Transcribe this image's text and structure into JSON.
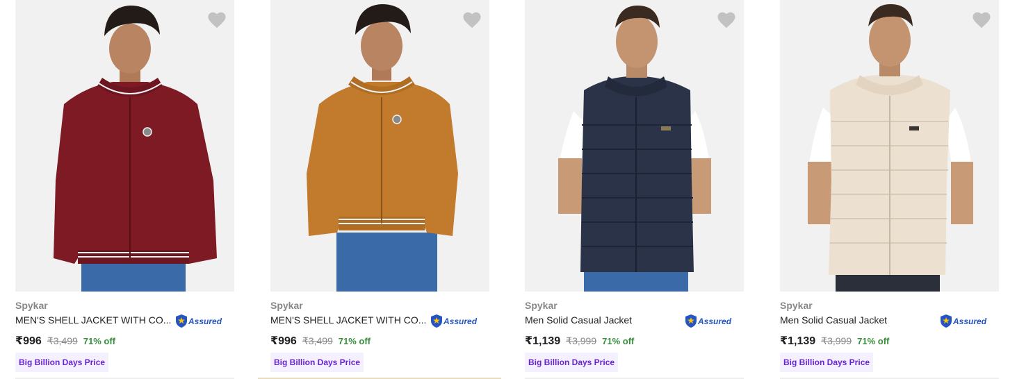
{
  "products": [
    {
      "brand": "Spykar",
      "title": "MEN'S SHELL JACKET WITH CO...",
      "assured_label": "Assured",
      "price": "₹996",
      "mrp": "₹3,499",
      "discount": "71% off",
      "badge": "Big Billion Days Price",
      "wishlist_icon": "heart-icon",
      "colors": {
        "garment": "#7d1a24",
        "trim": "#f2f2f2"
      }
    },
    {
      "brand": "Spykar",
      "title": "MEN'S SHELL JACKET WITH CO...",
      "assured_label": "Assured",
      "price": "₹996",
      "mrp": "₹3,499",
      "discount": "71% off",
      "badge": "Big Billion Days Price",
      "wishlist_icon": "heart-icon",
      "colors": {
        "garment": "#c27a2c",
        "trim": "#f2f2f2"
      }
    },
    {
      "brand": "Spykar",
      "title": "Men Solid Casual Jacket",
      "assured_label": "Assured",
      "price": "₹1,139",
      "mrp": "₹3,999",
      "discount": "71% off",
      "badge": "Big Billion Days Price",
      "wishlist_icon": "heart-icon",
      "colors": {
        "garment": "#2b3349",
        "trim": "#ffffff"
      }
    },
    {
      "brand": "Spykar",
      "title": "Men Solid Casual Jacket",
      "assured_label": "Assured",
      "price": "₹1,139",
      "mrp": "₹3,999",
      "discount": "71% off",
      "badge": "Big Billion Days Price",
      "wishlist_icon": "heart-icon",
      "colors": {
        "garment": "#ece0d0",
        "trim": "#ffffff"
      }
    }
  ],
  "theme": {
    "price_green": "#388e3c",
    "assured_blue": "#2455c3",
    "badge_purple": "#6725d2",
    "badge_bg": "#f5f0ff",
    "wishlist_gray": "#c2c2c2"
  }
}
